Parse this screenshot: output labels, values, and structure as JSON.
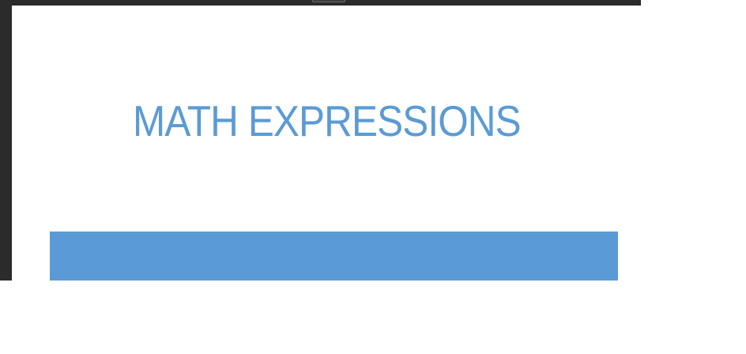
{
  "slide": {
    "title": "MATH EXPRESSIONS"
  },
  "colors": {
    "accent": "#5b9bd5",
    "chrome": "#2b2b2b",
    "background": "#ffffff"
  }
}
